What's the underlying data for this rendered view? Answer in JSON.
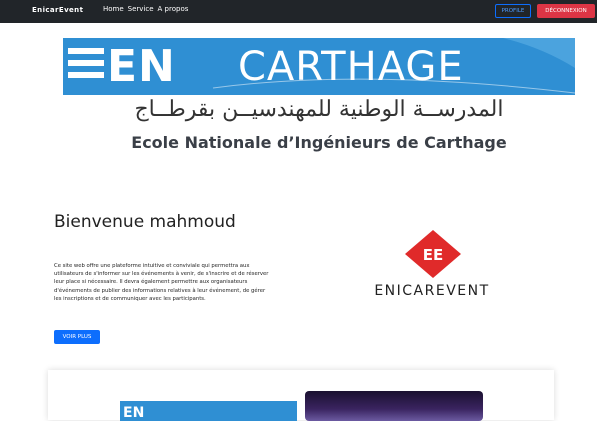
{
  "navbar": {
    "brand": "EnicarEvent",
    "links": [
      "Home",
      "Service",
      "A propos"
    ],
    "profile_label": "PROFILE",
    "logout_label": "DÉCONNEXION"
  },
  "banner": {
    "prefix": "EN",
    "name": "CARTHAGE",
    "arabic": "المدرســة الوطنية للمهندسيــن بقرطــاج",
    "school": "Ecole Nationale d’Ingénieurs de Carthage"
  },
  "main": {
    "welcome": "Bienvenue mahmoud",
    "description": "Ce site web offre une plateforme intuitive et conviviale qui permettra aux utilisateurs de s'informer sur les événements à venir, de s'inscrire et de réserver leur place si nécessaire. Il devra également permettre aux organisateurs d'événements de publier des informations relatives à leur événement, de gérer les inscriptions et de communiquer avec les participants.",
    "more_label": "VOIR PLUS"
  },
  "event_logo": {
    "initials": "EE",
    "name": "ENICAREVENT"
  },
  "colors": {
    "navbar": "#212529",
    "primary": "#0d6efd",
    "danger": "#dc3545",
    "banner": "#2f8fd3",
    "logo_red": "#e02a2a"
  }
}
